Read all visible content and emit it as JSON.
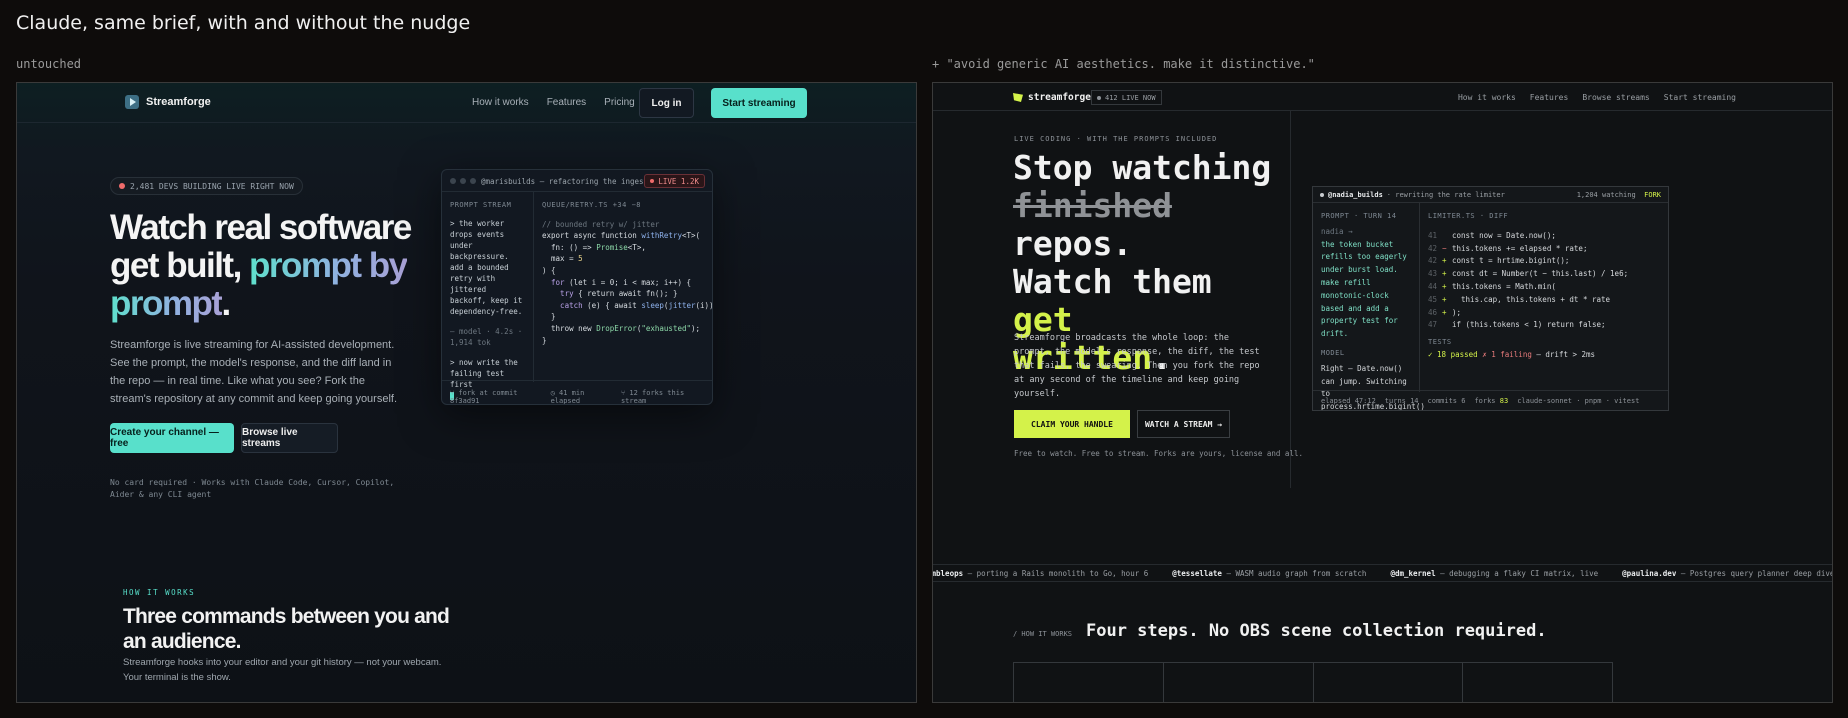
{
  "header": {
    "title": "Claude, same brief, with and without the nudge"
  },
  "panes": {
    "left_label": "untouched",
    "right_label": "+ \"avoid generic AI aesthetics. make it distinctive.\""
  },
  "left": {
    "brand": "Streamforge",
    "nav": {
      "links": [
        "How it works",
        "Features",
        "Pricing"
      ],
      "login": "Log in",
      "start": "Start streaming"
    },
    "badge": "2,481 DEVS BUILDING LIVE RIGHT NOW",
    "hero": {
      "line1": "Watch real software",
      "line2a": "get built,",
      "line2b": "prompt by",
      "line3": "prompt",
      "period": "."
    },
    "subtitle": "Streamforge is live streaming for AI-assisted development. See the prompt, the model's response, and the diff land in the repo — in real time. Like what you see? Fork the stream's repository at any commit and keep going yourself.",
    "cta_primary": "Create your channel — free",
    "cta_secondary": "Browse live streams",
    "note": "No card required · Works with Claude Code, Cursor, Copilot, Aider & any CLI agent",
    "card": {
      "title": "@marisbuilds — refactoring the ingest queue",
      "live": "LIVE 1.2K",
      "prompt_head": "PROMPT STREAM",
      "prompt1": "> the worker drops events under backpressure. add a bounded retry with jittered backoff, keep it dependency-free.",
      "model_meta": "— model · 4.2s · 1,914 tok",
      "prompt2": "> now write the failing test first",
      "file_head": "QUEUE/RETRY.TS +34 −8",
      "code": {
        "c1": "// bounded retry w/ jitter",
        "l2a": "export async function ",
        "l2b": "withRetry",
        "l2c": "<T>(",
        "l3a": "  fn: () => ",
        "l3b": "Promise",
        "l3c": "<T>,",
        "l4a": "  max = ",
        "l4b": "5",
        "l5": ") {",
        "l6a": "  for ",
        "l6b": "(let i = 0; i < max; i++) {",
        "l7a": "    try ",
        "l7b": "{ return await fn(); }",
        "l8a": "    catch ",
        "l8b": "(e) { await ",
        "l8c": "sleep",
        "l8d": "(",
        "l8e": "jitter",
        "l8f": "(i)); }",
        "l9": "  }",
        "l10a": "  throw new ",
        "l10b": "DropError",
        "l10c": "(",
        "l10d": "\"exhausted\"",
        "l10e": ");",
        "l11": "}"
      },
      "foot": [
        "⑂ fork at commit 8f3ad91",
        "◷ 41 min elapsed",
        "⑂ 12 forks this stream"
      ]
    },
    "section": {
      "eyebrow": "HOW IT WORKS",
      "title": "Three commands between you and an audience.",
      "body": "Streamforge hooks into your editor and your git history — not your webcam. Your terminal is the show."
    }
  },
  "right": {
    "brand": "streamforge",
    "live_pill": "412 LIVE NOW",
    "nav": [
      "How it works",
      "Features",
      "Browse streams",
      "Start streaming"
    ],
    "eyebrow": "LIVE CODING · WITH THE PROMPTS INCLUDED",
    "hero": {
      "l1": "Stop watching",
      "l2": "finished",
      "l3": "repos.",
      "l4a": "Watch them ",
      "l4b": "get",
      "l5a": "written",
      "l5b": "."
    },
    "subtitle": "Streamforge broadcasts the whole loop: the prompt, the model's response, the diff, the test that fails, the swearing. Then you fork the repo at any second of the timeline and keep going yourself.",
    "cta_primary": "CLAIM YOUR HANDLE",
    "cta_secondary": "WATCH A STREAM →",
    "note": "Free to watch. Free to stream. Forks are yours, license and all.",
    "card": {
      "handle": "@nadia_builds",
      "desc": "· rewriting the rate limiter",
      "watching": "1,204 watching",
      "fork": "FORK",
      "prompt_head": "PROMPT · TURN 14",
      "speaker": "nadia →",
      "prompt": "the token bucket refills too eagerly under burst load. make refill monotonic-clock based and add a property test for drift.",
      "model_head": "MODEL",
      "model": "Right — Date.now() can jump. Switching to process.hrtime.bigint() and clamping.",
      "diff_head": "LIMITER.TS · DIFF",
      "lines": [
        {
          "n": "41",
          "m": " ",
          "t": "const now = Date.now();"
        },
        {
          "n": "42",
          "m": "−",
          "t": "this.tokens += elapsed * rate;"
        },
        {
          "n": "42",
          "m": "+",
          "t": "const t = hrtime.bigint();"
        },
        {
          "n": "43",
          "m": "+",
          "t": "const dt = Number(t − this.last) / 1e6;"
        },
        {
          "n": "44",
          "m": "+",
          "t": "this.tokens = Math.min("
        },
        {
          "n": "45",
          "m": "+",
          "t": "  this.cap, this.tokens + dt * rate"
        },
        {
          "n": "46",
          "m": "+",
          "t": ");"
        },
        {
          "n": "47",
          "m": " ",
          "t": "if (this.tokens < 1) return false;"
        }
      ],
      "tests_head": "TESTS",
      "tests_pass": "✓ 18 passed",
      "tests_fail": "✗ 1 failing",
      "tests_rest": "— drift > 2ms",
      "foot": {
        "elapsed": "elapsed 47:12",
        "turns": "turns 14",
        "commits": "commits 6",
        "forks_label": "forks",
        "forks_value": "83",
        "stack": "claude-sonnet · pnpm · vitest"
      }
    },
    "ticker": [
      {
        "h": "umbleops",
        "t": "— porting a Rails monolith to Go, hour 6"
      },
      {
        "h": "@tessellate",
        "t": "— WASM audio graph from scratch"
      },
      {
        "h": "@dm_kernel",
        "t": "— debugging a flaky CI matrix, live"
      },
      {
        "h": "@paulina.dev",
        "t": "— Postgres query planner deep dive"
      }
    ],
    "section": {
      "eyebrow": "/ HOW IT WORKS",
      "title": "Four steps. No OBS scene collection required."
    }
  },
  "colors": {
    "teal": "#58e0cb",
    "lime": "#d4f24a",
    "live_red": "#ef6b6b"
  }
}
